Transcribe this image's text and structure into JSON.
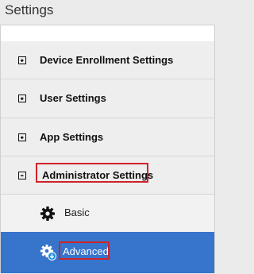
{
  "header": {
    "title": "Settings"
  },
  "colors": {
    "highlight": "#d0232a",
    "selected": "#3774cc"
  },
  "sections": [
    {
      "label": "Device Enrollment Settings",
      "icon": "plus-box-icon"
    },
    {
      "label": "User Settings",
      "icon": "plus-box-icon"
    },
    {
      "label": "App Settings",
      "icon": "plus-box-icon"
    },
    {
      "label": "Administrator Settings",
      "icon": "minus-box-icon"
    }
  ],
  "admin_items": [
    {
      "label": "Basic",
      "icon": "gear-icon"
    },
    {
      "label": "Advanced",
      "icon": "gear-download-icon"
    }
  ]
}
